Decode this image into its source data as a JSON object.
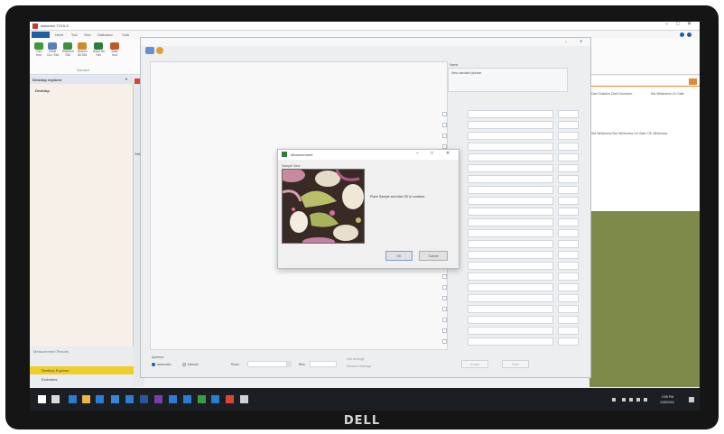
{
  "app": {
    "title": "datacolor TOOLS",
    "tabs": [
      "Home",
      "Tool",
      "View",
      "Calibration",
      "Tools"
    ],
    "ribbon_buttons": [
      "Std",
      "Clear",
      "Retrieve",
      "Search",
      "Save All",
      "Best"
    ],
    "ribbon_subs": [
      "Inst",
      "Cur. Std",
      "Std",
      "All Std",
      "Std",
      "Inst"
    ],
    "ribbon_group": "Standard",
    "left_panel_title": "Desktop explorer",
    "left_panel_item": "Desktop",
    "bottom_items": [
      "Measurement Results",
      "Desktop Explorer",
      "Estimates"
    ],
    "right_column_headers": [
      "Dark Solution Dark Exclusion",
      "Std Whiteness UV Safe"
    ],
    "right_mid_label": "Std Whiteness Bar Whiteness UV-Safe CIE Whiteness",
    "std_label": "Std"
  },
  "sample_window": {
    "name_label": "Name",
    "name_value": "New standard phrase",
    "aperture_label": "Aperture",
    "modes": [
      "Automatic",
      "Manual"
    ],
    "rows_label": "Rows",
    "bins_label": "Bins",
    "options": [
      "Use Average",
      "Measure Average"
    ],
    "buttons": [
      "Accept",
      "Save"
    ]
  },
  "dialog": {
    "title": "Measurement",
    "sample_label": "Sample View",
    "message": "Place Sample and click OK to continue.",
    "ok_label": "OK",
    "cancel_label": "Cancel"
  },
  "taskbar": {
    "icons": [
      "windows-icon",
      "search-icon",
      "edge-icon",
      "explorer-icon",
      "store-icon",
      "mail-icon",
      "photos-icon",
      "word-icon",
      "excel-icon",
      "onenote-icon",
      "outlook-icon",
      "app-icon",
      "tool-icon",
      "datacolor-icon",
      "settings-icon"
    ],
    "time": "2:55 PM",
    "date": "1/25/2016"
  },
  "brand": "DELL",
  "colors": {
    "desktop_green": "#7e8a4a",
    "accent_blue": "#1f5fa8",
    "highlight_yellow": "#f0cd28",
    "title_red": "#c8382f"
  }
}
